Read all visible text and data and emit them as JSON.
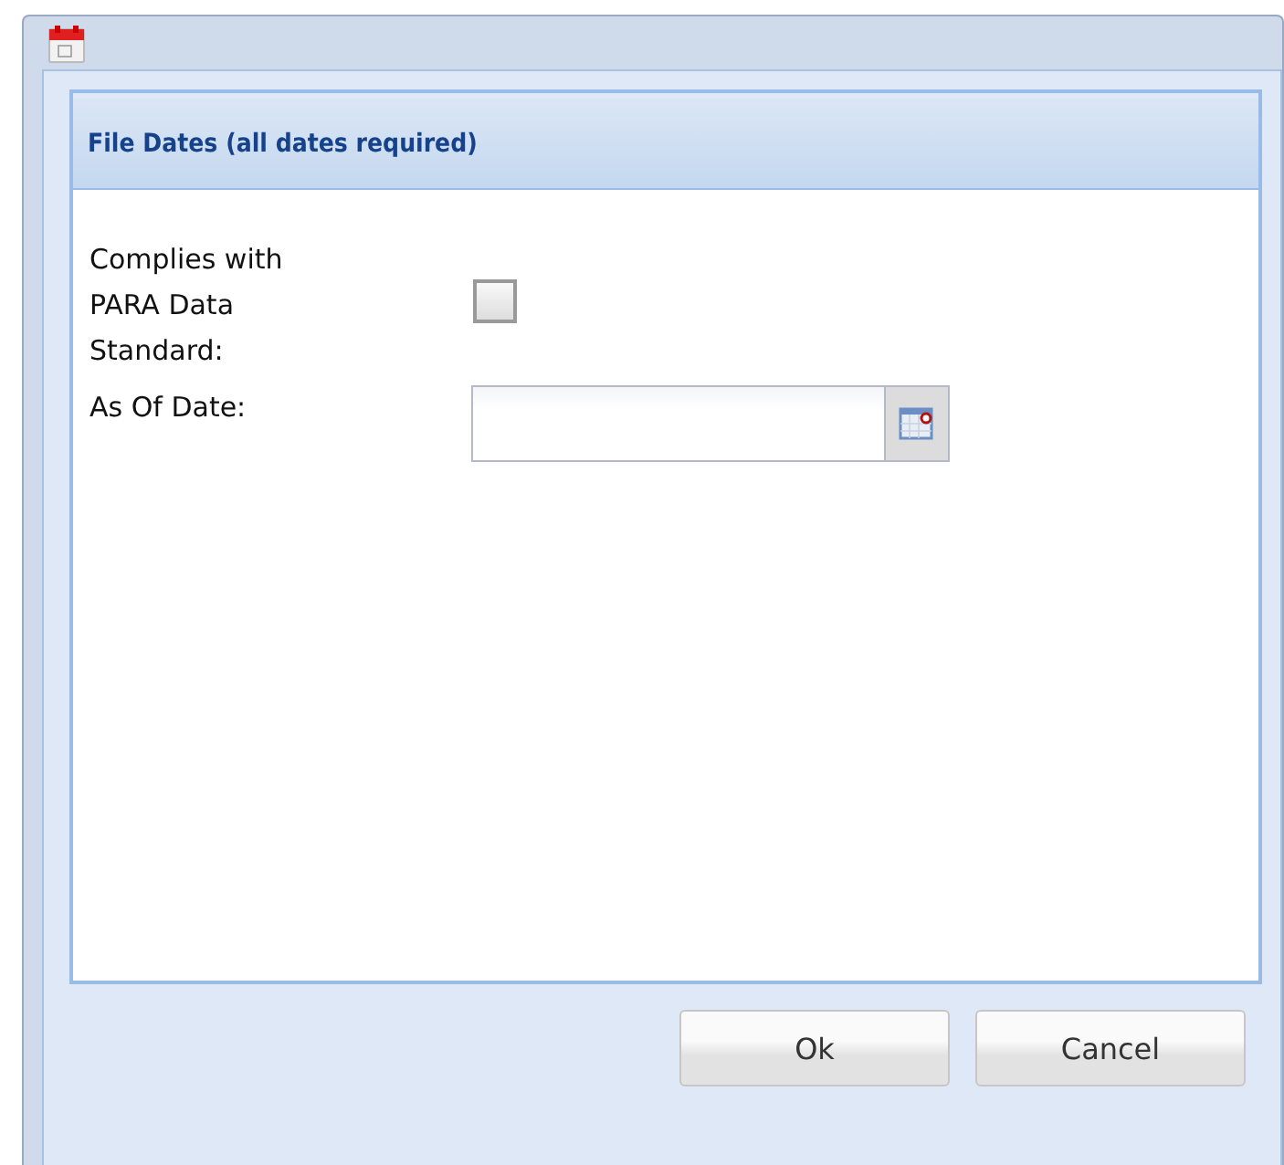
{
  "panel": {
    "title": "File Dates (all dates required)"
  },
  "fields": [
    {
      "kind": "checkbox",
      "label": "Complies with PARA Data Standard:",
      "checked": false
    },
    {
      "kind": "date",
      "label": "As Of Date:"
    }
  ],
  "buttons": [
    "Ok",
    "Cancel"
  ]
}
